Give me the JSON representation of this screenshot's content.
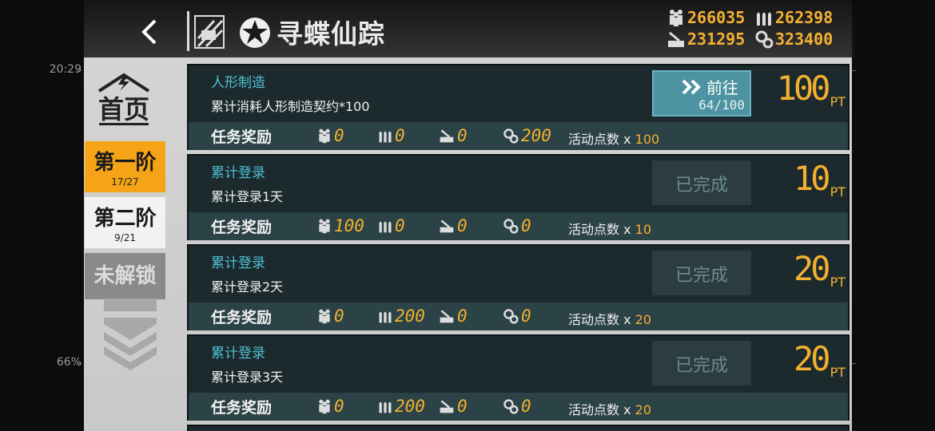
{
  "status": {
    "time": "20:29",
    "battery": "66%"
  },
  "header": {
    "title": "寻蝶仙踪"
  },
  "resources": {
    "manpower": "266035",
    "ammo": "262398",
    "rations": "231295",
    "parts": "323400"
  },
  "sidebar": {
    "home_label": "首页",
    "stages": [
      {
        "label": "第一阶",
        "count": "17/27"
      },
      {
        "label": "第二阶",
        "count": "9/21"
      },
      {
        "label": "未解锁"
      }
    ]
  },
  "missions": [
    {
      "title": "人形制造",
      "desc": "累计消耗人形制造契约*100",
      "reward_label": "任务奖励",
      "manpower": "0",
      "ammo": "0",
      "rations": "0",
      "parts": "200",
      "points_label": "活动点数 x ",
      "points": "100",
      "action": "前往",
      "progress": "64/100",
      "pt": "100",
      "pt_unit": "PT"
    },
    {
      "title": "累计登录",
      "desc": "累计登录1天",
      "reward_label": "任务奖励",
      "manpower": "100",
      "ammo": "0",
      "rations": "0",
      "parts": "0",
      "points_label": "活动点数 x ",
      "points": "10",
      "action": "已完成",
      "pt": "10",
      "pt_unit": "PT"
    },
    {
      "title": "累计登录",
      "desc": "累计登录2天",
      "reward_label": "任务奖励",
      "manpower": "0",
      "ammo": "200",
      "rations": "0",
      "parts": "0",
      "points_label": "活动点数 x ",
      "points": "20",
      "action": "已完成",
      "pt": "20",
      "pt_unit": "PT"
    },
    {
      "title": "累计登录",
      "desc": "累计登录3天",
      "reward_label": "任务奖励",
      "manpower": "0",
      "ammo": "200",
      "rations": "0",
      "parts": "0",
      "points_label": "活动点数 x ",
      "points": "20",
      "action": "已完成",
      "pt": "20",
      "pt_unit": "PT"
    }
  ],
  "colors": {
    "accent": "#f3b130",
    "stage_active": "#f5a417",
    "title_cyan": "#4fc0d4",
    "card_bg": "#1c2a2e"
  },
  "icons": [
    "back-icon",
    "manpower-icon",
    "ammo-icon",
    "rations-icon",
    "parts-icon",
    "home-icon",
    "forward-icon"
  ]
}
